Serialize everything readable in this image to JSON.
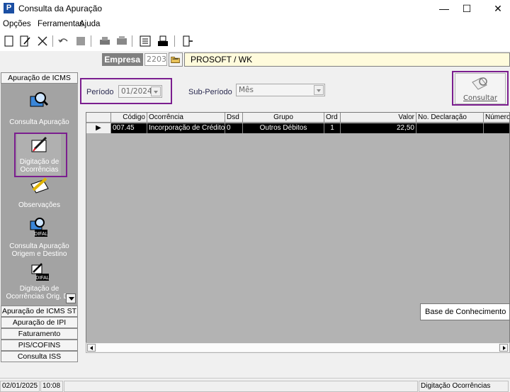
{
  "window": {
    "title": "Consulta da Apuração",
    "minimize": "—",
    "maximize": "☐",
    "close": "✕"
  },
  "menu": [
    "Opções",
    "Ferramentas",
    "Ajuda"
  ],
  "company": {
    "label": "Empresa",
    "code": "2203",
    "name": "PROSOFT / WK"
  },
  "nav": {
    "top_category": "Apuração de ICMS",
    "items": [
      {
        "label": "Consulta Apuração",
        "icon": "magnifier-computer-icon"
      },
      {
        "label": "Digitação de Ocorrências",
        "icon": "notepad-pen-icon"
      },
      {
        "label": "Observações",
        "icon": "pencil-paper-icon"
      },
      {
        "label": "Consulta Apuração Origem e Destino",
        "icon": "difal-magnifier-icon",
        "badge": "DIFAL"
      },
      {
        "label": "Digitação de Ocorrências Orig. De",
        "icon": "difal-notepad-icon",
        "badge": "DIFAL"
      }
    ],
    "bottom_categories": [
      "Apuração de ICMS ST",
      "Apuração de IPI",
      "Faturamento",
      "PIS/COFINS",
      "Consulta ISS"
    ]
  },
  "filters": {
    "period_label": "Período",
    "period_value": "01/2024",
    "subperiod_label": "Sub-Período",
    "subperiod_value": "Mês",
    "consult_button": "Consultar"
  },
  "grid": {
    "columns": [
      "Código",
      "Ocorrência",
      "Dsd",
      "Grupo",
      "Ord",
      "Valor",
      "No. Declaração",
      "Número"
    ],
    "rows": [
      {
        "marker": "▶",
        "codigo": "007.45",
        "ocorrencia": "Incorporação de Crédito",
        "dsd": "0",
        "grupo": "Outros Débitos",
        "ord": "1",
        "valor": "22,50",
        "declaracao": "",
        "numero": ""
      }
    ]
  },
  "tooltip": "Base de Conhecimento",
  "status": {
    "date": "02/01/2025",
    "time": "10:08",
    "message": "",
    "screen": "Digitação Ocorrências"
  },
  "colors": {
    "highlight": "#7b1e8f",
    "nav_panel": "#a3a3a3",
    "company_bg": "#fffbdc"
  }
}
